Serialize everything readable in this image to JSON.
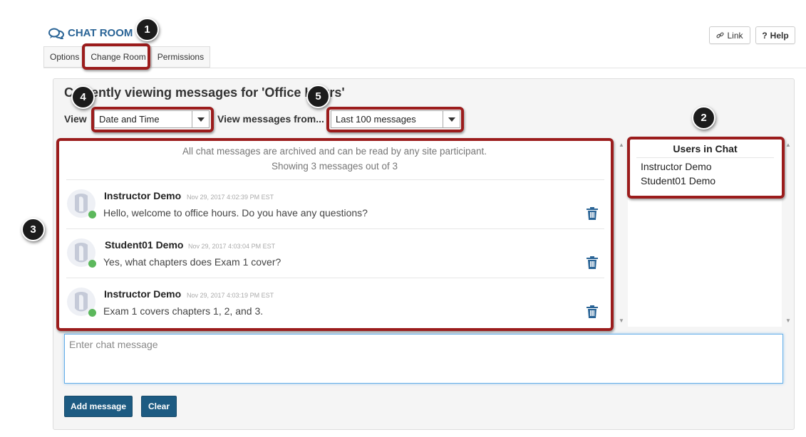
{
  "header": {
    "title": "CHAT ROOM",
    "title_icon": "chat-bubbles-icon",
    "link_label": "Link",
    "help_label": "Help"
  },
  "tabs": [
    {
      "label": "Options"
    },
    {
      "label": "Change Room"
    },
    {
      "label": "Permissions"
    }
  ],
  "main": {
    "heading": "Currently viewing messages for 'Office Hours'",
    "view_label": "View",
    "view_selected": "Date and Time",
    "from_label": "View messages from...",
    "from_selected": "Last 100 messages"
  },
  "messages_panel": {
    "info_line1": "All chat messages are archived and can be read by any site participant.",
    "info_line2": "Showing 3 messages out of 3",
    "messages": [
      {
        "author": "Instructor Demo",
        "timestamp": "Nov 29, 2017 4:02:39 PM EST",
        "text": "Hello, welcome to office hours. Do you have any questions?"
      },
      {
        "author": "Student01 Demo",
        "timestamp": "Nov 29, 2017 4:03:04 PM EST",
        "text": "Yes, what chapters does Exam 1 cover?"
      },
      {
        "author": "Instructor Demo",
        "timestamp": "Nov 29, 2017 4:03:19 PM EST",
        "text": "Exam 1 covers chapters 1, 2, and 3."
      }
    ]
  },
  "users_panel": {
    "title": "Users in Chat",
    "users": [
      "Instructor Demo",
      "Student01 Demo"
    ]
  },
  "composer": {
    "placeholder": "Enter chat message",
    "add_label": "Add message",
    "clear_label": "Clear"
  },
  "callouts": [
    "1",
    "2",
    "3",
    "4",
    "5"
  ],
  "colors": {
    "accent": "#1d5b82",
    "highlight": "#9b1c1c",
    "presence": "#5cb85c",
    "title": "#2a6496"
  }
}
